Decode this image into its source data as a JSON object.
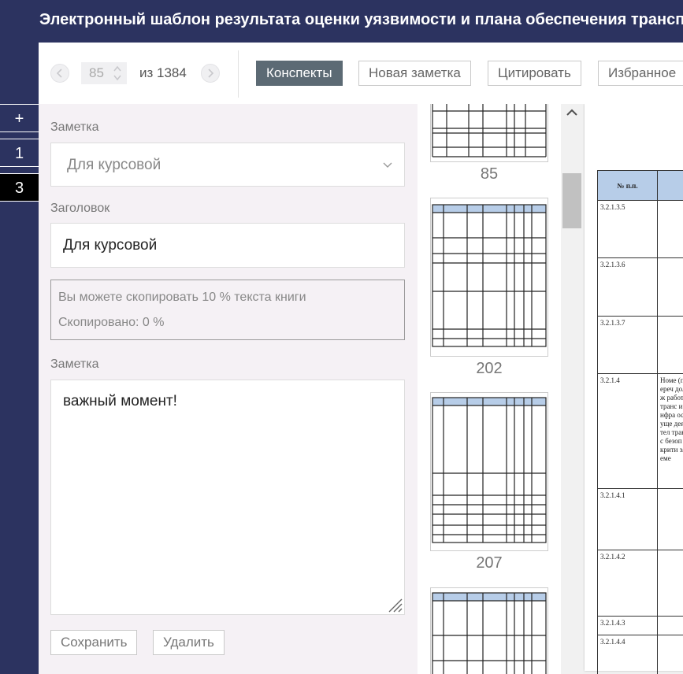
{
  "window": {
    "title": "Электронный шаблон результата оценки уязвимости и плана обеспечения транспортной безопасности"
  },
  "rail": {
    "items": [
      "+",
      "1",
      "3"
    ],
    "active_index": 2
  },
  "toolbar": {
    "prev_icon": "chevron-left-icon",
    "next_icon": "chevron-right-icon",
    "page_current": "85",
    "page_total_label": "из 1384",
    "tabs": [
      {
        "label": "Конспекты",
        "active": true
      },
      {
        "label": "Новая заметка",
        "active": false
      },
      {
        "label": "Цитировать",
        "active": false
      },
      {
        "label": "Избранное",
        "active": false
      }
    ]
  },
  "note_form": {
    "category_label": "Заметка",
    "category_value": "Для курсовой",
    "heading_label": "Заголовок",
    "heading_value": "Для курсовой",
    "copy_info": {
      "limit_text": "Вы можете скопировать 10 % текста книги",
      "copied_text": "Скопировано: 0 %"
    },
    "note_label": "Заметка",
    "note_value": "важный момент!",
    "save_label": "Сохранить",
    "delete_label": "Удалить"
  },
  "thumbnails": {
    "pages": [
      "85",
      "202",
      "207"
    ]
  },
  "document": {
    "header_col1": "№ п.п.",
    "rows": [
      {
        "num": "3.2.1.3.5",
        "text": ""
      },
      {
        "num": "3.2.1.3.6",
        "text": ""
      },
      {
        "num": "3.2.1.3.7",
        "text": ""
      },
      {
        "num": "3.2.1.4",
        "text": "Номе (переч долж работ транс инфра осуще деятел транс безоп крити элеме"
      },
      {
        "num": "3.2.1.4.1",
        "text": ""
      },
      {
        "num": "3.2.1.4.2",
        "text": ""
      },
      {
        "num": "3.2.1.4.3",
        "text": ""
      },
      {
        "num": "3.2.1.4.4",
        "text": ""
      }
    ]
  },
  "colors": {
    "brand_navy": "#2c3360",
    "active_tab": "#5c6a74",
    "panel_bg": "#f5f1f5",
    "table_header": "#b7cde8"
  }
}
